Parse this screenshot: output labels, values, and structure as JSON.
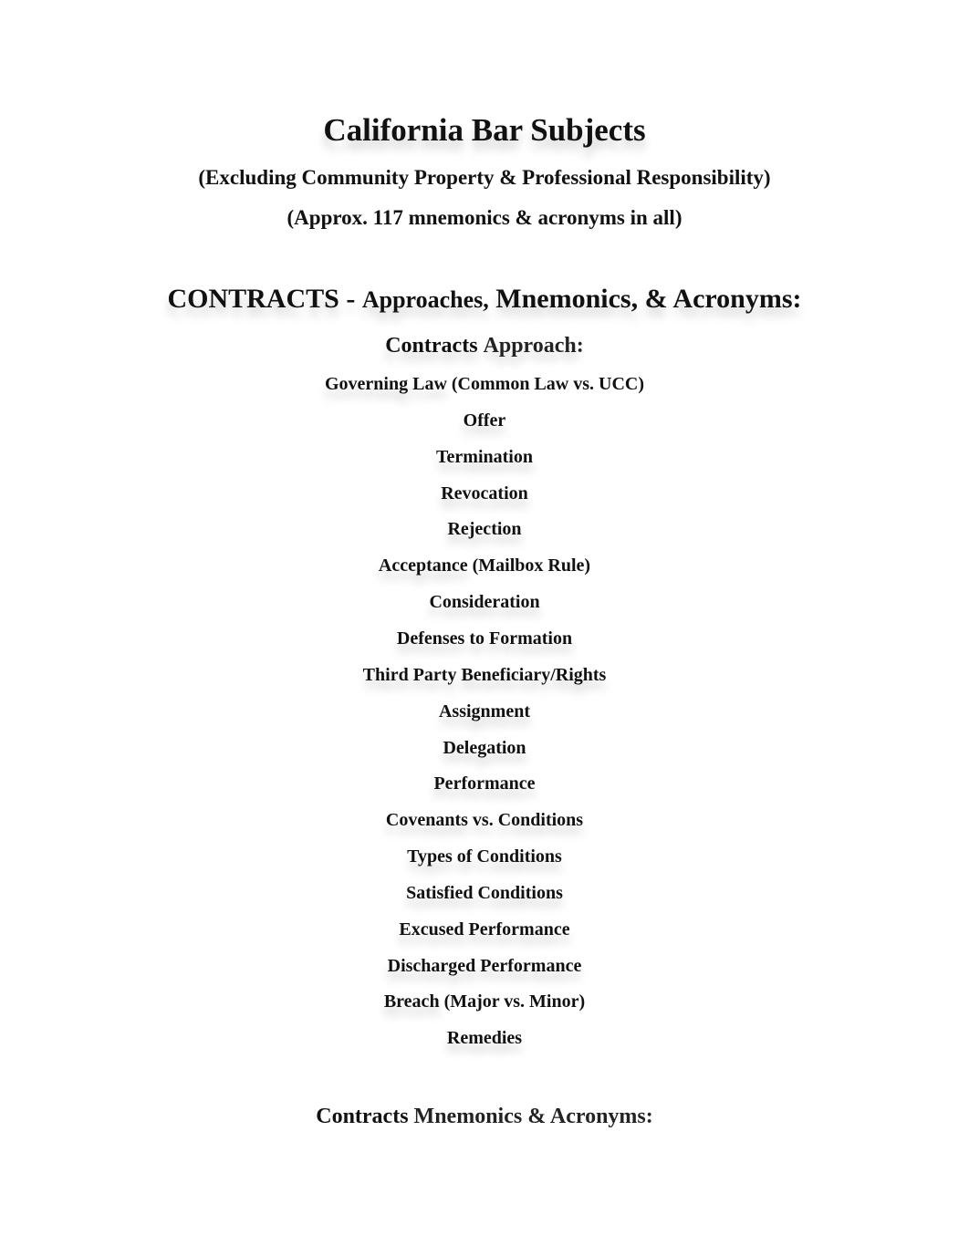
{
  "document": {
    "title": "California Bar Subjects",
    "subtitle_1": "(Excluding Community Property & Professional Responsibility)",
    "subtitle_2": "(Approx. 117 mnemonics & acronyms in all)"
  },
  "section": {
    "heading_main": "CONTRACTS -",
    "heading_approaches": "Approaches,",
    "heading_rest": "Mnemonics, & Acronyms:",
    "approach_heading_bold": "Contracts",
    "approach_heading_rest": "Approach:",
    "approach_items": [
      {
        "main": "Governing Law",
        "rest": " (Common Law vs. UCC)"
      },
      {
        "main": "Offer",
        "rest": ""
      },
      {
        "main": "Termination",
        "rest": ""
      },
      {
        "main": "Revocation",
        "rest": ""
      },
      {
        "main": "Rejection",
        "rest": ""
      },
      {
        "main": "Acceptance",
        "rest": " (Mailbox Rule)"
      },
      {
        "main": "Consideration",
        "rest": ""
      },
      {
        "main": "Defenses to Formation",
        "rest": ""
      },
      {
        "main": "Third Party Beneficiary/Rights",
        "rest": ""
      },
      {
        "main": "Assignment",
        "rest": ""
      },
      {
        "main": "Delegation",
        "rest": ""
      },
      {
        "main": "Performance",
        "rest": ""
      },
      {
        "main": "Covenants vs. Conditions",
        "rest": ""
      },
      {
        "main": "Types of Conditions",
        "rest": ""
      },
      {
        "main": "Satisfied Conditions",
        "rest": ""
      },
      {
        "main": "Excused Performance",
        "rest": ""
      },
      {
        "main": "Discharged Performance",
        "rest": ""
      },
      {
        "main": "Breach",
        "rest": " (Major vs. Minor)"
      },
      {
        "main": "Remedies",
        "rest": ""
      }
    ],
    "mnemonics_heading_bold": "Contracts",
    "mnemonics_heading_rest": "Mnemonics & Acronyms:"
  }
}
